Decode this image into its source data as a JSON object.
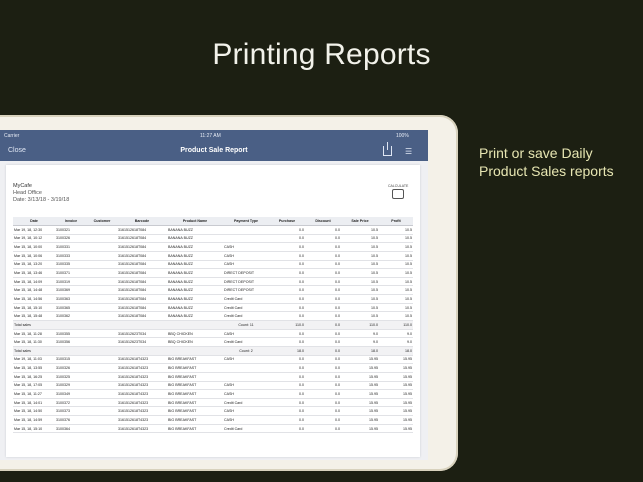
{
  "headline": "Printing Reports",
  "tagline": [
    "Print or save Daily",
    "Product Sales reports"
  ],
  "status_bar": {
    "carrier": "Carrier",
    "time": "11:27 AM",
    "battery": "100%"
  },
  "nav": {
    "close_label": "Close",
    "title": "Product Sale Report",
    "share_icon": "share-icon",
    "filter_icon": "filter-icon"
  },
  "report": {
    "company": "MyCafe",
    "location": "Head Office",
    "date_range": "Date: 3/13/18 - 3/19/18",
    "logo_text": "CALCULATE",
    "columns": [
      "Date",
      "Invoice",
      "Customer",
      "Barcode",
      "Product Name",
      "Payment Type",
      "Purchase",
      "Discount",
      "Sale Price",
      "Profit"
    ],
    "rows": [
      {
        "type": "row",
        "cells": [
          "Mar 19, 18, 12:30",
          "3100321",
          "",
          "3161512618T084",
          "BANANA BUZZ",
          "",
          "0.0",
          "0.0",
          "10.5",
          "10.5"
        ]
      },
      {
        "type": "row",
        "cells": [
          "Mar 19, 18, 10:12",
          "3100326",
          "",
          "3161512618T084",
          "BANANA BUZZ",
          "",
          "0.0",
          "0.0",
          "10.5",
          "10.5"
        ]
      },
      {
        "type": "row",
        "cells": [
          "Mar 15, 18, 10:00",
          "3100331",
          "",
          "3161512618T084",
          "BANANA BUZZ",
          "CASH",
          "0.0",
          "0.0",
          "10.5",
          "10.5"
        ]
      },
      {
        "type": "row",
        "cells": [
          "Mar 15, 18, 10:06",
          "3100333",
          "",
          "3161512618T084",
          "BANANA BUZZ",
          "CASH",
          "0.0",
          "0.0",
          "10.5",
          "10.5"
        ]
      },
      {
        "type": "row",
        "cells": [
          "Mar 15, 18, 13:20",
          "3100335",
          "",
          "3161512618T084",
          "BANANA BUZZ",
          "CASH",
          "0.0",
          "0.0",
          "10.5",
          "10.5"
        ]
      },
      {
        "type": "row",
        "cells": [
          "Mar 15, 18, 13:46",
          "3100371",
          "",
          "3161512618T084",
          "BANANA BUZZ",
          "DIRECT DEPOSIT",
          "0.0",
          "0.0",
          "10.5",
          "10.5"
        ]
      },
      {
        "type": "row",
        "cells": [
          "Mar 15, 18, 14:09",
          "3100319",
          "",
          "3161512618T084",
          "BANANA BUZZ",
          "DIRECT DEPOSIT",
          "0.0",
          "0.0",
          "10.5",
          "10.5"
        ]
      },
      {
        "type": "row",
        "cells": [
          "Mar 15, 18, 14:48",
          "3100369",
          "",
          "3161512618T084",
          "BANANA BUZZ",
          "DIRECT DEPOSIT",
          "0.0",
          "0.0",
          "10.5",
          "10.5"
        ]
      },
      {
        "type": "row",
        "cells": [
          "Mar 15, 18, 14:56",
          "3100363",
          "",
          "3161512618T084",
          "BANANA BUZZ",
          "Credit Card",
          "0.0",
          "0.0",
          "10.5",
          "10.5"
        ]
      },
      {
        "type": "row",
        "cells": [
          "Mar 15, 18, 15:10",
          "3100365",
          "",
          "3161512618T084",
          "BANANA BUZZ",
          "Credit Card",
          "0.0",
          "0.0",
          "10.5",
          "10.5"
        ]
      },
      {
        "type": "row",
        "cells": [
          "Mar 15, 18, 15:48",
          "3100362",
          "",
          "3161512618T084",
          "BANANA BUZZ",
          "Credit Card",
          "0.0",
          "0.0",
          "10.5",
          "10.5"
        ]
      },
      {
        "type": "total",
        "cells": [
          "Total sales",
          "",
          "",
          "",
          "",
          "Count: 11",
          "110.0",
          "0.0",
          "110.0",
          "110.0"
        ]
      },
      {
        "type": "row",
        "cells": [
          "Mar 15, 18, 11:28",
          "3100355",
          "",
          "3161512623T034",
          "BBQ CHICKEN",
          "CASH",
          "0.0",
          "0.0",
          "9.0",
          "9.0"
        ]
      },
      {
        "type": "row",
        "cells": [
          "Mar 15, 18, 11:30",
          "3100356",
          "",
          "3161512623T034",
          "BBQ CHICKEN",
          "Credit Card",
          "0.0",
          "0.0",
          "9.0",
          "9.0"
        ]
      },
      {
        "type": "total",
        "cells": [
          "Total sales",
          "",
          "",
          "",
          "",
          "Count: 2",
          "18.0",
          "0.0",
          "18.0",
          "18.0"
        ]
      },
      {
        "type": "row",
        "cells": [
          "Mar 19, 18, 11:03",
          "3100315",
          "",
          "3161512618T4323",
          "BIG BREAKFAST",
          "CASH",
          "0.0",
          "0.0",
          "15.95",
          "15.95"
        ]
      },
      {
        "type": "row",
        "cells": [
          "Mar 15, 18, 13:55",
          "3100326",
          "",
          "3161512618T4323",
          "BIG BREAKFAST",
          "",
          "0.0",
          "0.0",
          "15.95",
          "15.95"
        ]
      },
      {
        "type": "row",
        "cells": [
          "Mar 15, 18, 16:25",
          "3100325",
          "",
          "3161512618T4323",
          "BIG BREAKFAST",
          "",
          "0.0",
          "0.0",
          "15.95",
          "15.95"
        ]
      },
      {
        "type": "row",
        "cells": [
          "Mar 15, 18, 17:05",
          "3100329",
          "",
          "3161512618T4323",
          "BIG BREAKFAST",
          "CASH",
          "0.0",
          "0.0",
          "15.95",
          "15.95"
        ]
      },
      {
        "type": "row",
        "cells": [
          "Mar 15, 18, 11:27",
          "3100349",
          "",
          "3161512618T4323",
          "BIG BREAKFAST",
          "CASH",
          "0.0",
          "0.0",
          "15.95",
          "15.95"
        ]
      },
      {
        "type": "row",
        "cells": [
          "Mar 15, 18, 14:01",
          "3100372",
          "",
          "3161512618T4323",
          "BIG BREAKFAST",
          "Credit Card",
          "0.0",
          "0.0",
          "15.95",
          "15.95"
        ]
      },
      {
        "type": "row",
        "cells": [
          "Mar 15, 18, 14:50",
          "3100373",
          "",
          "3161512618T4323",
          "BIG BREAKFAST",
          "CASH",
          "0.0",
          "0.0",
          "15.95",
          "15.95"
        ]
      },
      {
        "type": "row",
        "cells": [
          "Mar 15, 18, 14:59",
          "3100376",
          "",
          "3161512618T4323",
          "BIG BREAKFAST",
          "CASH",
          "0.0",
          "0.0",
          "15.95",
          "15.95"
        ]
      },
      {
        "type": "row",
        "cells": [
          "Mar 15, 18, 15:10",
          "3100364",
          "",
          "3161512618T4323",
          "BIG BREAKFAST",
          "Credit Card",
          "0.0",
          "0.0",
          "15.95",
          "15.95"
        ]
      }
    ]
  }
}
